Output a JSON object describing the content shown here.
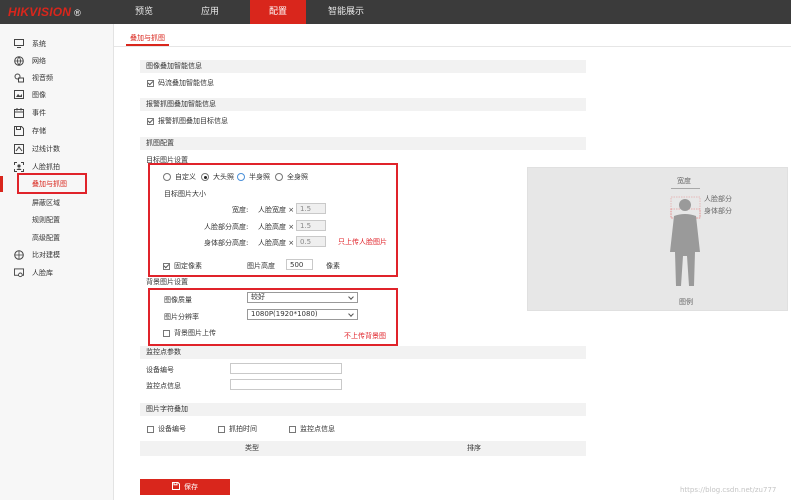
{
  "brand": {
    "name": "HIKVISION",
    "mark": "®"
  },
  "nav": [
    {
      "label": "预览",
      "active": false
    },
    {
      "label": "应用",
      "active": false
    },
    {
      "label": "配置",
      "active": true
    },
    {
      "label": "智能展示",
      "active": false
    }
  ],
  "sidebar": {
    "items": [
      {
        "label": "系统",
        "icon": "monitor-icon"
      },
      {
        "label": "网络",
        "icon": "globe-icon"
      },
      {
        "label": "视音频",
        "icon": "audio-video-icon"
      },
      {
        "label": "图像",
        "icon": "image-icon"
      },
      {
        "label": "事件",
        "icon": "calendar-icon"
      },
      {
        "label": "存储",
        "icon": "save-icon"
      },
      {
        "label": "过线计数",
        "icon": "line-count-icon"
      },
      {
        "label": "人脸抓拍",
        "icon": "face-capture-icon"
      },
      {
        "label": "叠加与抓图",
        "sub": true,
        "active": true
      },
      {
        "label": "屏蔽区域",
        "sub": true
      },
      {
        "label": "规则配置",
        "sub": true
      },
      {
        "label": "高级配置",
        "sub": true
      },
      {
        "label": "比对建模",
        "icon": "compare-icon"
      },
      {
        "label": "人脸库",
        "icon": "face-library-icon"
      }
    ]
  },
  "tab": {
    "label": "叠加与抓图"
  },
  "overlay_info": {
    "title": "图像叠加智能信息",
    "checkbox": "码流叠加智能信息",
    "checked": true
  },
  "alarm_overlay": {
    "title": "报警抓图叠加智能信息",
    "checkbox": "报警抓图叠加目标信息",
    "checked": true
  },
  "capture_config": {
    "title": "抓图配置",
    "target_settings": {
      "title": "目标图片设置",
      "radios": [
        {
          "label": "自定义",
          "checked": false
        },
        {
          "label": "大头照",
          "checked": true
        },
        {
          "label": "半身照",
          "checked": false
        },
        {
          "label": "全身照",
          "checked": false
        }
      ],
      "size_title": "目标图片大小",
      "rows": [
        {
          "label": "宽度:",
          "unit": "人脸宽度",
          "mult": "×",
          "value": "1.5"
        },
        {
          "label": "人脸部分高度:",
          "unit": "人脸高度",
          "mult": "×",
          "value": "1.5"
        },
        {
          "label": "身体部分高度:",
          "unit": "人脸高度",
          "mult": "×",
          "value": "0.5"
        }
      ],
      "fixed_pixel": {
        "label": "固定像素",
        "checked": true
      },
      "height": {
        "label": "图片高度",
        "value": "500",
        "unit": "像素"
      },
      "note": "只上传人脸图片"
    },
    "background": {
      "title": "背景图片设置",
      "quality_label": "图像质量",
      "quality_value": "较好",
      "resolution_label": "图片分辨率",
      "resolution_value": "1080P(1920*1080)",
      "upload": {
        "label": "背景图片上传",
        "checked": false
      },
      "note": "不上传背景图"
    },
    "preview": {
      "width_label": "宽度",
      "face_label": "人脸部分",
      "body_label": "身体部分",
      "caption": "图例"
    }
  },
  "monitor": {
    "title": "监控点参数",
    "device_label": "设备编号",
    "device_value": "",
    "info_label": "监控点信息",
    "info_value": ""
  },
  "char_overlay": {
    "title": "图片字符叠加",
    "options": [
      {
        "label": "设备编号",
        "checked": false
      },
      {
        "label": "抓拍时间",
        "checked": false
      },
      {
        "label": "监控点信息",
        "checked": false
      }
    ],
    "columns": [
      "类型",
      "排序"
    ]
  },
  "save": {
    "label": "保存"
  },
  "watermark": "https://blog.csdn.net/zu777"
}
